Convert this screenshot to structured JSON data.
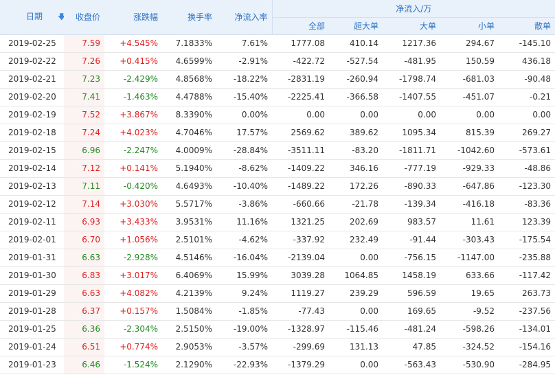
{
  "header": {
    "date": "日期",
    "close": "收盘价",
    "change": "涨跌幅",
    "turnover": "换手率",
    "net_inflow_rate": "净流入率",
    "net_inflow_group": "净流入/万",
    "all": "全部",
    "super_large": "超大单",
    "large": "大单",
    "small": "小单",
    "retail": "散单",
    "sort_icon": "arrow-down-icon",
    "sort_arrow_glyph": "🡇"
  },
  "colors": {
    "up": "#e02020",
    "down": "#1f8b1f",
    "header_text": "#2f73c4",
    "header_bg": "#e9f1fb"
  },
  "rows": [
    {
      "date": "2019-02-25",
      "close": "7.59",
      "change": "+4.545%",
      "turnover": "7.1833%",
      "rate": "7.61%",
      "all": "1777.08",
      "super": "410.14",
      "large": "1217.36",
      "small": "294.67",
      "retail": "-145.10",
      "dir": "up"
    },
    {
      "date": "2019-02-22",
      "close": "7.26",
      "change": "+0.415%",
      "turnover": "4.6599%",
      "rate": "-2.91%",
      "all": "-422.72",
      "super": "-527.54",
      "large": "-481.95",
      "small": "150.59",
      "retail": "436.18",
      "dir": "up"
    },
    {
      "date": "2019-02-21",
      "close": "7.23",
      "change": "-2.429%",
      "turnover": "4.8568%",
      "rate": "-18.22%",
      "all": "-2831.19",
      "super": "-260.94",
      "large": "-1798.74",
      "small": "-681.03",
      "retail": "-90.48",
      "dir": "down"
    },
    {
      "date": "2019-02-20",
      "close": "7.41",
      "change": "-1.463%",
      "turnover": "4.4788%",
      "rate": "-15.40%",
      "all": "-2225.41",
      "super": "-366.58",
      "large": "-1407.55",
      "small": "-451.07",
      "retail": "-0.21",
      "dir": "down"
    },
    {
      "date": "2019-02-19",
      "close": "7.52",
      "change": "+3.867%",
      "turnover": "8.3390%",
      "rate": "0.00%",
      "all": "0.00",
      "super": "0.00",
      "large": "0.00",
      "small": "0.00",
      "retail": "0.00",
      "dir": "up"
    },
    {
      "date": "2019-02-18",
      "close": "7.24",
      "change": "+4.023%",
      "turnover": "4.7046%",
      "rate": "17.57%",
      "all": "2569.62",
      "super": "389.62",
      "large": "1095.34",
      "small": "815.39",
      "retail": "269.27",
      "dir": "up"
    },
    {
      "date": "2019-02-15",
      "close": "6.96",
      "change": "-2.247%",
      "turnover": "4.0009%",
      "rate": "-28.84%",
      "all": "-3511.11",
      "super": "-83.20",
      "large": "-1811.71",
      "small": "-1042.60",
      "retail": "-573.61",
      "dir": "down"
    },
    {
      "date": "2019-02-14",
      "close": "7.12",
      "change": "+0.141%",
      "turnover": "5.1940%",
      "rate": "-8.62%",
      "all": "-1409.22",
      "super": "346.16",
      "large": "-777.19",
      "small": "-929.33",
      "retail": "-48.86",
      "dir": "up"
    },
    {
      "date": "2019-02-13",
      "close": "7.11",
      "change": "-0.420%",
      "turnover": "4.6493%",
      "rate": "-10.40%",
      "all": "-1489.22",
      "super": "172.26",
      "large": "-890.33",
      "small": "-647.86",
      "retail": "-123.30",
      "dir": "down"
    },
    {
      "date": "2019-02-12",
      "close": "7.14",
      "change": "+3.030%",
      "turnover": "5.5717%",
      "rate": "-3.86%",
      "all": "-660.66",
      "super": "-21.78",
      "large": "-139.34",
      "small": "-416.18",
      "retail": "-83.36",
      "dir": "up"
    },
    {
      "date": "2019-02-11",
      "close": "6.93",
      "change": "+3.433%",
      "turnover": "3.9531%",
      "rate": "11.16%",
      "all": "1321.25",
      "super": "202.69",
      "large": "983.57",
      "small": "11.61",
      "retail": "123.39",
      "dir": "up"
    },
    {
      "date": "2019-02-01",
      "close": "6.70",
      "change": "+1.056%",
      "turnover": "2.5101%",
      "rate": "-4.62%",
      "all": "-337.92",
      "super": "232.49",
      "large": "-91.44",
      "small": "-303.43",
      "retail": "-175.54",
      "dir": "up"
    },
    {
      "date": "2019-01-31",
      "close": "6.63",
      "change": "-2.928%",
      "turnover": "4.5146%",
      "rate": "-16.04%",
      "all": "-2139.04",
      "super": "0.00",
      "large": "-756.15",
      "small": "-1147.00",
      "retail": "-235.88",
      "dir": "down"
    },
    {
      "date": "2019-01-30",
      "close": "6.83",
      "change": "+3.017%",
      "turnover": "6.4069%",
      "rate": "15.99%",
      "all": "3039.28",
      "super": "1064.85",
      "large": "1458.19",
      "small": "633.66",
      "retail": "-117.42",
      "dir": "up"
    },
    {
      "date": "2019-01-29",
      "close": "6.63",
      "change": "+4.082%",
      "turnover": "4.2139%",
      "rate": "9.24%",
      "all": "1119.27",
      "super": "239.29",
      "large": "596.59",
      "small": "19.65",
      "retail": "263.73",
      "dir": "up"
    },
    {
      "date": "2019-01-28",
      "close": "6.37",
      "change": "+0.157%",
      "turnover": "1.5084%",
      "rate": "-1.85%",
      "all": "-77.43",
      "super": "0.00",
      "large": "169.65",
      "small": "-9.52",
      "retail": "-237.56",
      "dir": "up"
    },
    {
      "date": "2019-01-25",
      "close": "6.36",
      "change": "-2.304%",
      "turnover": "2.5150%",
      "rate": "-19.00%",
      "all": "-1328.97",
      "super": "-115.46",
      "large": "-481.24",
      "small": "-598.26",
      "retail": "-134.01",
      "dir": "down"
    },
    {
      "date": "2019-01-24",
      "close": "6.51",
      "change": "+0.774%",
      "turnover": "2.9053%",
      "rate": "-3.57%",
      "all": "-299.69",
      "super": "131.13",
      "large": "47.85",
      "small": "-324.52",
      "retail": "-154.16",
      "dir": "up"
    },
    {
      "date": "2019-01-23",
      "close": "6.46",
      "change": "-1.524%",
      "turnover": "2.1290%",
      "rate": "-22.93%",
      "all": "-1379.29",
      "super": "0.00",
      "large": "-563.43",
      "small": "-530.90",
      "retail": "-284.95",
      "dir": "down"
    }
  ]
}
